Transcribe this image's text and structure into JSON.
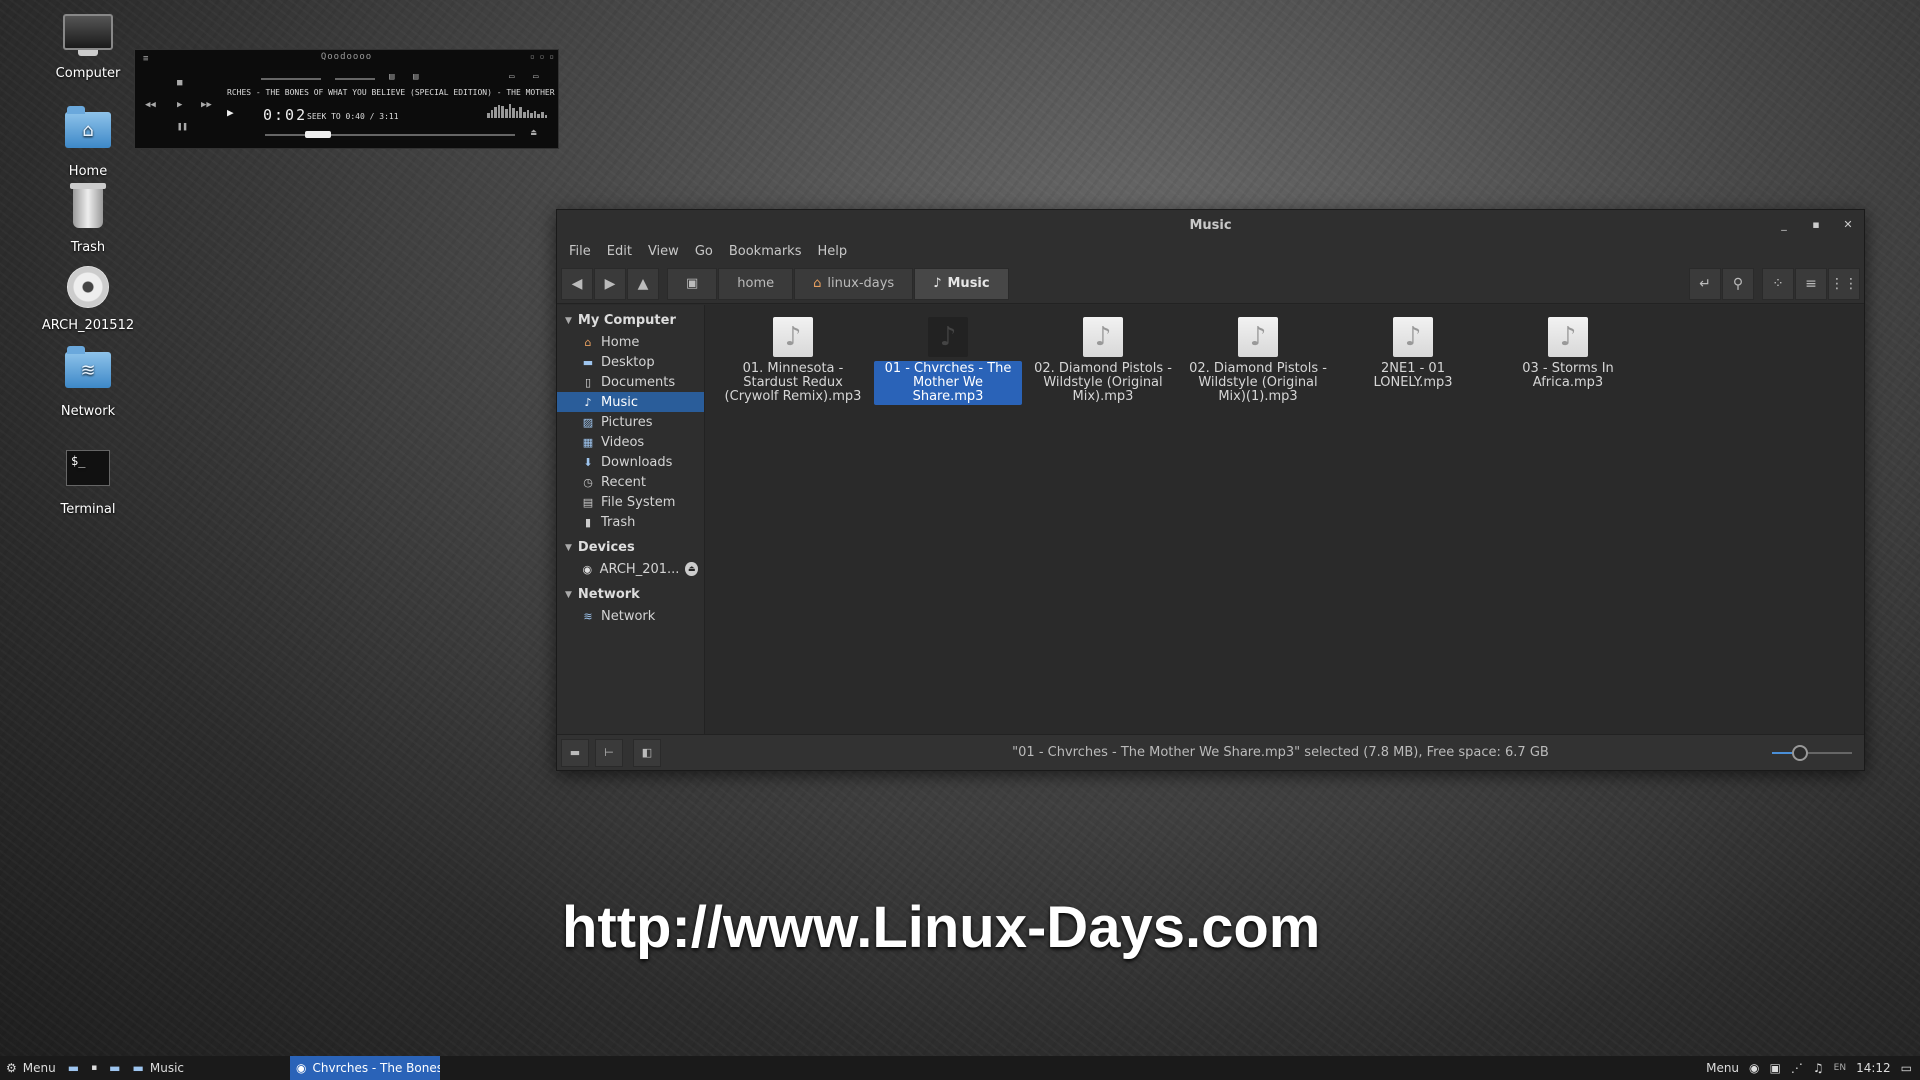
{
  "desktop": {
    "icons": [
      {
        "label": "Computer"
      },
      {
        "label": "Home"
      },
      {
        "label": "Trash"
      },
      {
        "label": "ARCH_201512"
      },
      {
        "label": "Network"
      },
      {
        "label": "Terminal"
      }
    ]
  },
  "player": {
    "title": "Qoodoooo",
    "marquee": "RCHES - THE BONES OF WHAT YOU BELIEVE (SPECIAL EDITION) - THE MOTHER WE SHARE",
    "time": "0:02",
    "seek_text": "SEEK TO 0:40 / 3:11",
    "progress": 0.21
  },
  "window": {
    "title": "Music",
    "menu": [
      "File",
      "Edit",
      "View",
      "Go",
      "Bookmarks",
      "Help"
    ],
    "breadcrumbs": [
      "home",
      "linux-days",
      "Music"
    ],
    "sidebar": {
      "sections": [
        {
          "title": "My Computer",
          "items": [
            "Home",
            "Desktop",
            "Documents",
            "Music",
            "Pictures",
            "Videos",
            "Downloads",
            "Recent",
            "File System",
            "Trash"
          ]
        },
        {
          "title": "Devices",
          "items": [
            "ARCH_201..."
          ]
        },
        {
          "title": "Network",
          "items": [
            "Network"
          ]
        }
      ]
    },
    "files": [
      {
        "name": "01. Minnesota - Stardust Redux (Crywolf Remix).mp3",
        "selected": false
      },
      {
        "name": "01 - Chvrches - The Mother We Share.mp3",
        "selected": true
      },
      {
        "name": "02. Diamond Pistols - Wildstyle (Original Mix).mp3",
        "selected": false
      },
      {
        "name": "02. Diamond Pistols - Wildstyle (Original Mix)(1).mp3",
        "selected": false
      },
      {
        "name": "2NE1 - 01 LONELY.mp3",
        "selected": false
      },
      {
        "name": "03 - Storms In Africa.mp3",
        "selected": false
      }
    ],
    "status": "\"01 - Chvrches - The Mother We Share.mp3\" selected (7.8 MB), Free space: 6.7 GB",
    "zoom_level": 0.35
  },
  "watermark": "http://www.Linux-Days.com",
  "taskbar": {
    "menu_label": "Menu",
    "music_label": "Music",
    "active_task": "Chvrches - The Bones ...",
    "tray_menu": "Menu",
    "lang": "EN",
    "clock": "14:12"
  },
  "colors": {
    "selection": "#2a63b8",
    "sidebar_selection": "#2a5d9a"
  }
}
